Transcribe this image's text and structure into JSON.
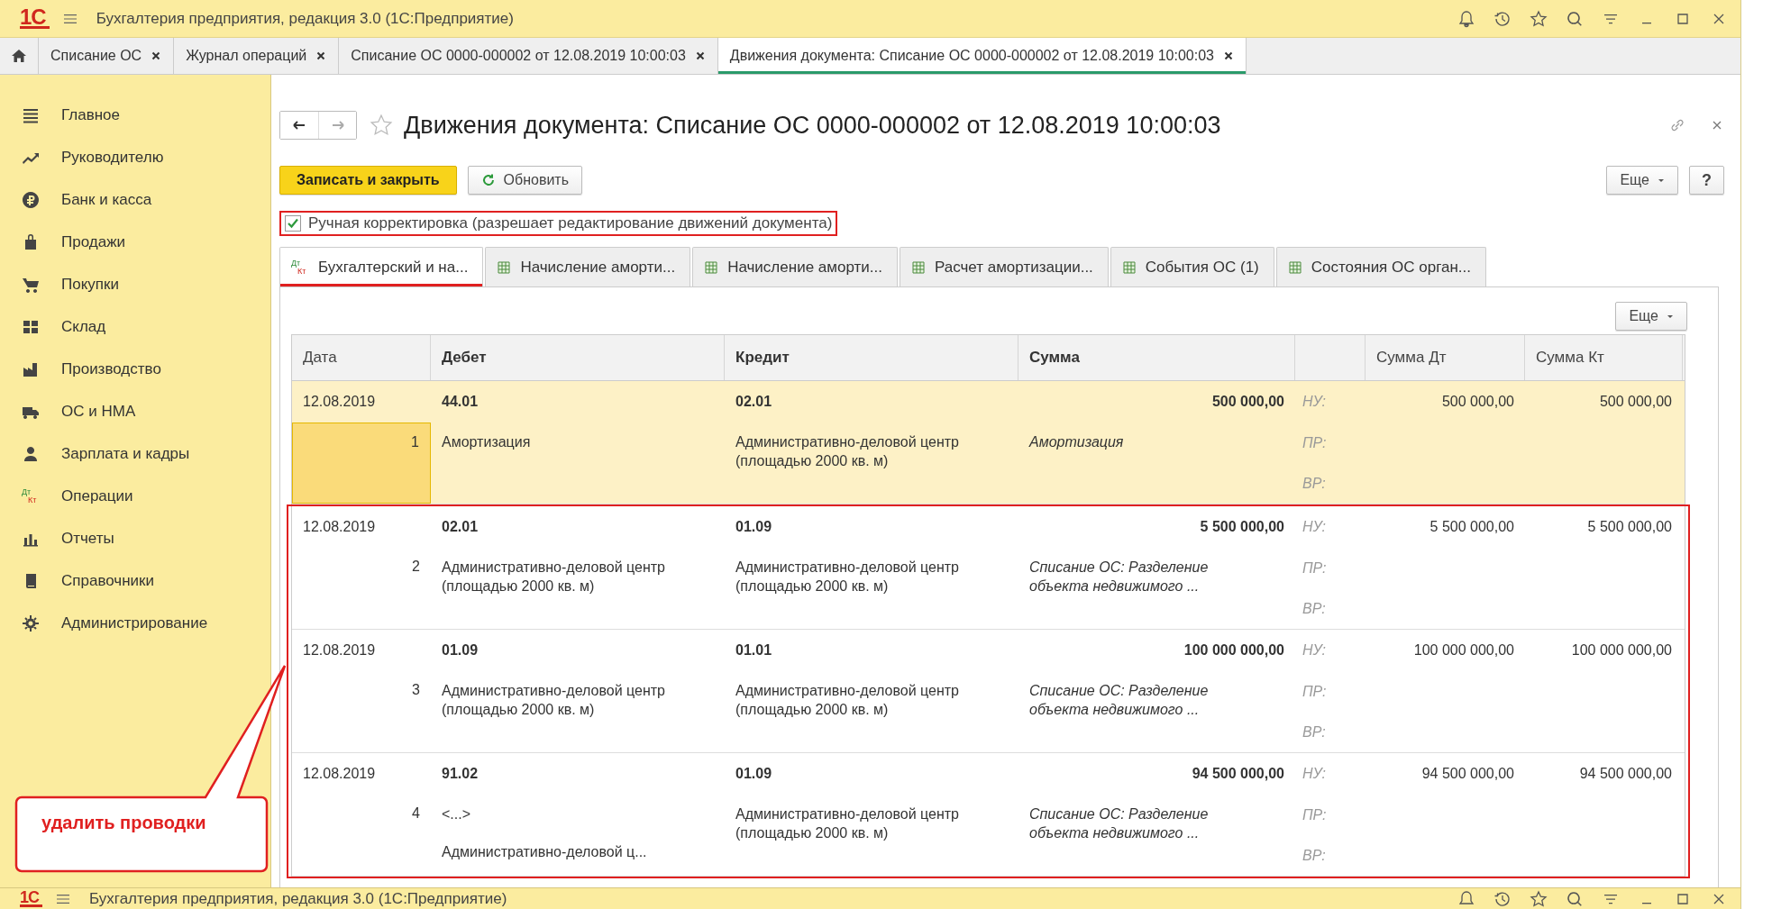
{
  "window": {
    "logo": "1С",
    "title": "Бухгалтерия предприятия, редакция 3.0  (1С:Предприятие)"
  },
  "open_tabs": [
    {
      "label": "Списание ОС",
      "selected": false
    },
    {
      "label": "Журнал операций",
      "selected": false
    },
    {
      "label": "Списание ОС 0000-000002 от 12.08.2019 10:00:03",
      "selected": false
    },
    {
      "label": "Движения документа: Списание ОС 0000-000002 от 12.08.2019 10:00:03",
      "selected": true
    }
  ],
  "sidebar": {
    "items": [
      {
        "label": "Главное"
      },
      {
        "label": "Руководителю"
      },
      {
        "label": "Банк и касса"
      },
      {
        "label": "Продажи"
      },
      {
        "label": "Покупки"
      },
      {
        "label": "Склад"
      },
      {
        "label": "Производство"
      },
      {
        "label": "ОС и НМА"
      },
      {
        "label": "Зарплата и кадры"
      },
      {
        "label": "Операции",
        "icon_letters": [
          "Дт",
          "Кт"
        ]
      },
      {
        "label": "Отчеты"
      },
      {
        "label": "Справочники"
      },
      {
        "label": "Администрирование"
      }
    ]
  },
  "form": {
    "title": "Движения документа: Списание ОС 0000-000002 от 12.08.2019 10:00:03",
    "buttons": {
      "save": "Записать и закрыть",
      "refresh": "Обновить",
      "more": "Еще",
      "help": "?"
    },
    "manual_edit": {
      "label": "Ручная корректировка (разрешает редактирование движений документа)",
      "checked": true,
      "marked": true
    },
    "tabs": [
      {
        "label": "Бухгалтерский и на...",
        "selected": true,
        "icon_letters": [
          "Дт",
          "Кт"
        ]
      },
      {
        "label": "Начисление аморти...",
        "selected": false
      },
      {
        "label": "Начисление аморти...",
        "selected": false
      },
      {
        "label": "Расчет амортизации...",
        "selected": false
      },
      {
        "label": "События ОС (1)",
        "selected": false
      },
      {
        "label": "Состояния ОС орган...",
        "selected": false
      }
    ],
    "table_more": "Еще",
    "table": {
      "columns": [
        {
          "label": "Дата",
          "bold": false
        },
        {
          "label": "Дебет",
          "bold": true
        },
        {
          "label": "Кредит",
          "bold": true
        },
        {
          "label": "Сумма",
          "bold": true
        },
        {
          "label": "Сумма Дт",
          "bold": false
        },
        {
          "label": "Сумма Кт",
          "bold": false
        }
      ],
      "rows": [
        {
          "date": "12.08.2019",
          "number": "1",
          "debit": {
            "account": "44.01",
            "subconto": [
              "Амортизация"
            ]
          },
          "credit": {
            "account": "02.01",
            "subconto": [
              "Административно-деловой центр (площадью 2000 кв. м)"
            ]
          },
          "amount": "500 000,00",
          "content": "Амортизация",
          "ledgers": [
            "НУ:",
            "ПР:",
            "ВР:"
          ],
          "sum_dt": "500 000,00",
          "sum_kt": "500 000,00",
          "selected": true,
          "marked": false
        },
        {
          "date": "12.08.2019",
          "number": "2",
          "debit": {
            "account": "02.01",
            "subconto": [
              "Административно-деловой центр (площадью 2000 кв. м)"
            ]
          },
          "credit": {
            "account": "01.09",
            "subconto": [
              "Административно-деловой центр (площадью 2000 кв. м)"
            ]
          },
          "amount": "5 500 000,00",
          "content": "Списание ОС: Разделение объекта недвижимого ...",
          "ledgers": [
            "НУ:",
            "ПР:",
            "ВР:"
          ],
          "sum_dt": "5 500 000,00",
          "sum_kt": "5 500 000,00",
          "selected": false,
          "marked": true
        },
        {
          "date": "12.08.2019",
          "number": "3",
          "debit": {
            "account": "01.09",
            "subconto": [
              "Административно-деловой центр (площадью 2000 кв. м)"
            ]
          },
          "credit": {
            "account": "01.01",
            "subconto": [
              "Административно-деловой центр (площадью 2000 кв. м)"
            ]
          },
          "amount": "100 000 000,00",
          "content": "Списание ОС: Разделение объекта недвижимого ...",
          "ledgers": [
            "НУ:",
            "ПР:",
            "ВР:"
          ],
          "sum_dt": "100 000 000,00",
          "sum_kt": "100 000 000,00",
          "selected": false,
          "marked": true
        },
        {
          "date": "12.08.2019",
          "number": "4",
          "debit": {
            "account": "91.02",
            "subconto": [
              "<...>",
              "Административно-деловой ц..."
            ]
          },
          "credit": {
            "account": "01.09",
            "subconto": [
              "Административно-деловой центр (площадью 2000 кв. м)"
            ]
          },
          "amount": "94 500 000,00",
          "content": "Списание ОС: Разделение объекта недвижимого ...",
          "ledgers": [
            "НУ:",
            "ПР:",
            "ВР:"
          ],
          "sum_dt": "94 500 000,00",
          "sum_kt": "94 500 000,00",
          "selected": false,
          "marked": true
        }
      ]
    }
  },
  "callout": {
    "text": "удалить проводки"
  },
  "second_window": {
    "logo": "1С",
    "title": "Бухгалтерия предприятия, редакция 3.0  (1С:Предприятие)"
  }
}
